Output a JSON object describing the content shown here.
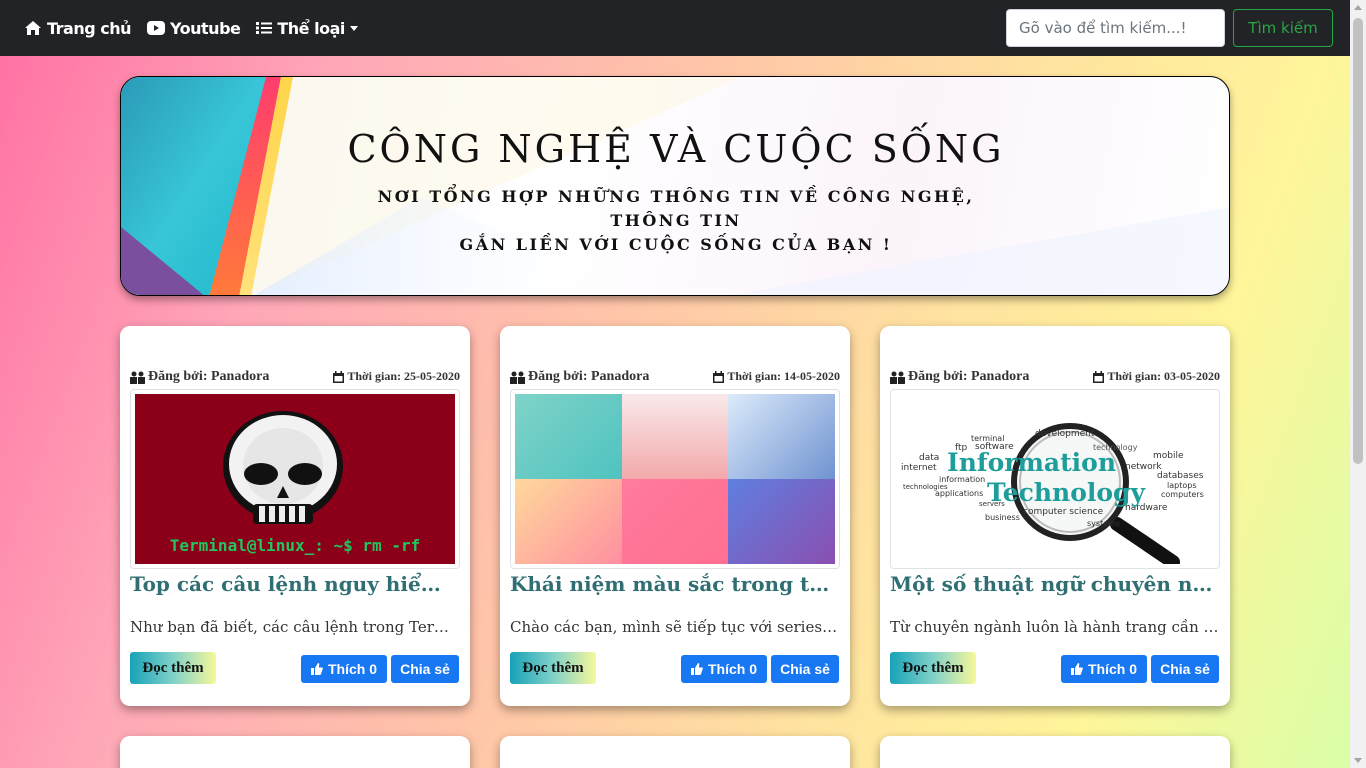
{
  "nav": {
    "home_label": "Trang chủ",
    "youtube_label": "Youtube",
    "category_label": "Thể loại",
    "search_placeholder": "Gõ vào để tìm kiếm...!",
    "search_button": "Tìm kiếm"
  },
  "banner": {
    "title": "CÔNG NGHỆ VÀ CUỘC SỐNG",
    "subtitle_line1": "NƠI TỔNG HỢP NHỮNG THÔNG TIN VỀ CÔNG NGHỆ, THÔNG TIN",
    "subtitle_line2": "GẮN LIỀN VỚI CUỘC SỐNG CỦA BẠN !"
  },
  "colors": {
    "navbar_bg": "#222326",
    "accent_green": "#28a745",
    "title_teal": "#2f6f73",
    "facebook_blue": "#1877f2"
  },
  "posts": [
    {
      "author": "Đăng bởi: Panadora",
      "time": "Thời gian: 25-05-2020",
      "image_caption": "Terminal@linux_: ~$ rm -rf",
      "title": "Top các câu lệnh nguy hiểm trên Linux",
      "desc": "Như bạn đã biết, các câu lệnh trong Terminal",
      "read_more": "Đọc thêm",
      "like": "Thích 0",
      "share": "Chia sẻ"
    },
    {
      "author": "Đăng bởi: Panadora",
      "time": "Thời gian: 14-05-2020",
      "title": "Khái niệm màu sắc trong thiết kế web",
      "desc": "Chào các bạn, mình sẽ tiếp tục với series chủ đề",
      "read_more": "Đọc thêm",
      "like": "Thích 0",
      "share": "Chia sẻ"
    },
    {
      "author": "Đăng bởi: Panadora",
      "time": "Thời gian: 03-05-2020",
      "image_words": [
        "development",
        "technology",
        "mobile",
        "network",
        "databases",
        "laptops",
        "computers",
        "hardware",
        "software",
        "terminal",
        "ftp",
        "data",
        "internet",
        "technologies",
        "information",
        "applications",
        "business",
        "computer science",
        "systems",
        "servers"
      ],
      "image_title_1": "Information",
      "image_title_2": "Technology",
      "title": "Một số thuật ngữ chuyên ngành IT",
      "desc": "Từ chuyên ngành luôn là hành trang cần thiết",
      "read_more": "Đọc thêm",
      "like": "Thích 0",
      "share": "Chia sẻ"
    }
  ]
}
